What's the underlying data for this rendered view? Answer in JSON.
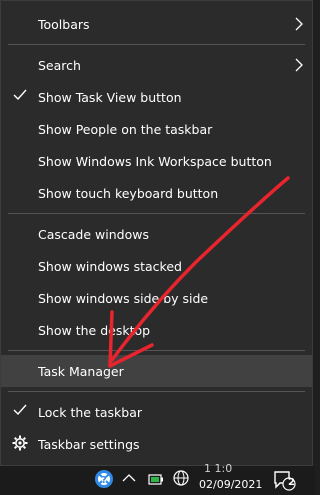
{
  "menu": {
    "items": [
      {
        "label": "Toolbars",
        "submenu": true
      },
      {
        "label": "Search",
        "submenu": true
      },
      {
        "label": "Show Task View button",
        "checked": true
      },
      {
        "label": "Show People on the taskbar"
      },
      {
        "label": "Show Windows Ink Workspace button"
      },
      {
        "label": "Show touch keyboard button"
      },
      {
        "label": "Cascade windows"
      },
      {
        "label": "Show windows stacked"
      },
      {
        "label": "Show windows side by side"
      },
      {
        "label": "Show the desktop"
      },
      {
        "label": "Task Manager",
        "highlighted": true
      },
      {
        "label": "Lock the taskbar",
        "checked": true
      },
      {
        "label": "Taskbar settings",
        "icon": "gear-icon"
      }
    ]
  },
  "taskbar": {
    "date": "02/09/2021",
    "time_partial": "1 1:0",
    "notification_count": "2",
    "tray_icons": [
      "help-icon",
      "chevron-up-icon",
      "battery-icon",
      "network-globe-icon",
      "notification-icon"
    ]
  },
  "annotation": {
    "type": "red-arrow",
    "color": "#e8242d",
    "points_to": "Task Manager"
  },
  "colors": {
    "menu_bg": "#2b2b2b",
    "highlight_bg": "#414141",
    "separator": "#545454",
    "text": "#ffffff"
  }
}
